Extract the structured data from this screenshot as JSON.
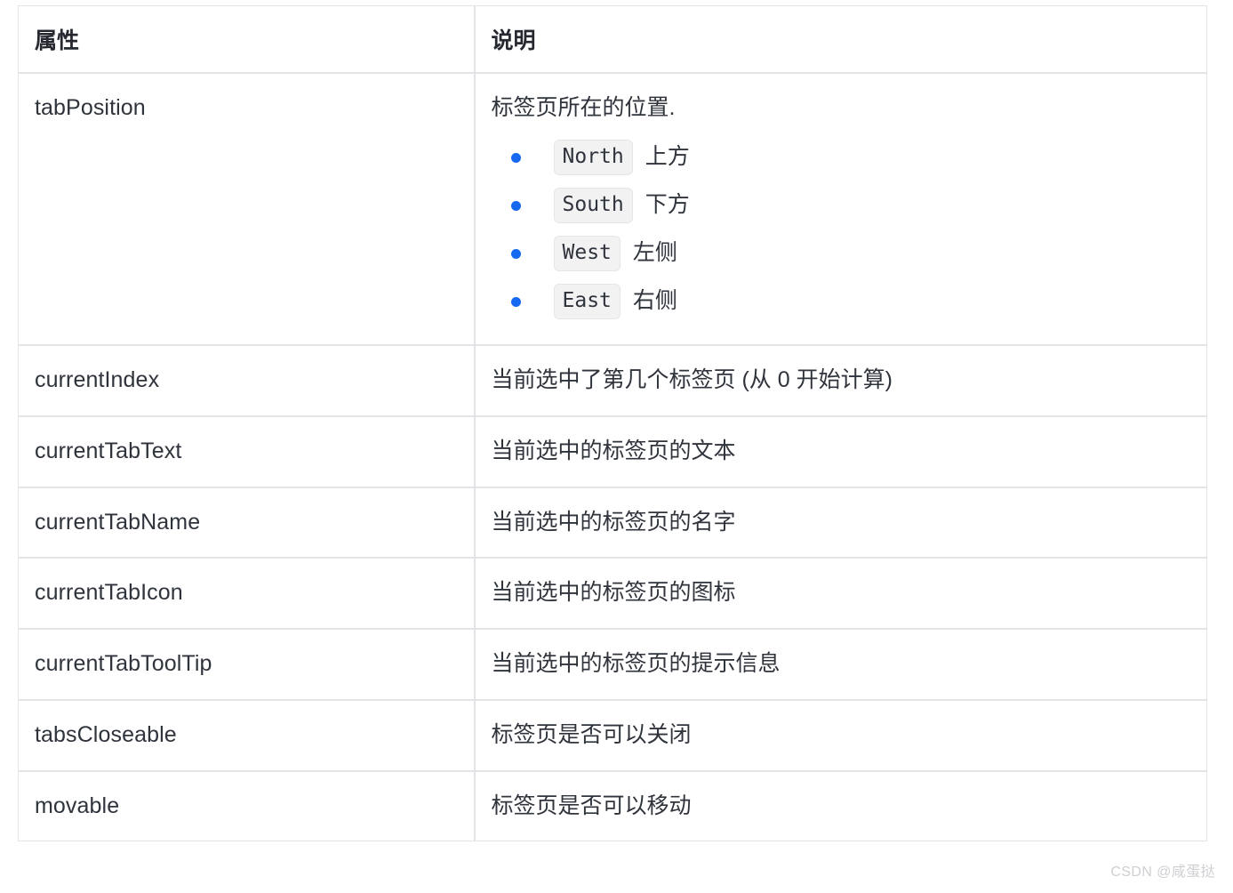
{
  "table": {
    "headers": [
      "属性",
      "说明"
    ],
    "rows": [
      {
        "attr": "tabPosition",
        "desc": "标签页所在的位置.",
        "options": [
          {
            "code": "North",
            "label": "上方"
          },
          {
            "code": "South",
            "label": "下方"
          },
          {
            "code": "West",
            "label": "左侧"
          },
          {
            "code": "East",
            "label": "右侧"
          }
        ]
      },
      {
        "attr": "currentIndex",
        "desc": "当前选中了第几个标签页 (从 0 开始计算)"
      },
      {
        "attr": "currentTabText",
        "desc": "当前选中的标签页的文本"
      },
      {
        "attr": "currentTabName",
        "desc": "当前选中的标签页的名字"
      },
      {
        "attr": "currentTabIcon",
        "desc": "当前选中的标签页的图标"
      },
      {
        "attr": "currentTabToolTip",
        "desc": "当前选中的标签页的提示信息"
      },
      {
        "attr": "tabsCloseable",
        "desc": "标签页是否可以关闭"
      },
      {
        "attr": "movable",
        "desc": "标签页是否可以移动"
      }
    ]
  },
  "watermark": "CSDN @咸蛋挞",
  "colors": {
    "bullet": "#1668f0",
    "border": "#e3e4e8",
    "code_bg": "#f2f2f3",
    "text": "#2f333b",
    "watermark": "#cfcfd3"
  }
}
